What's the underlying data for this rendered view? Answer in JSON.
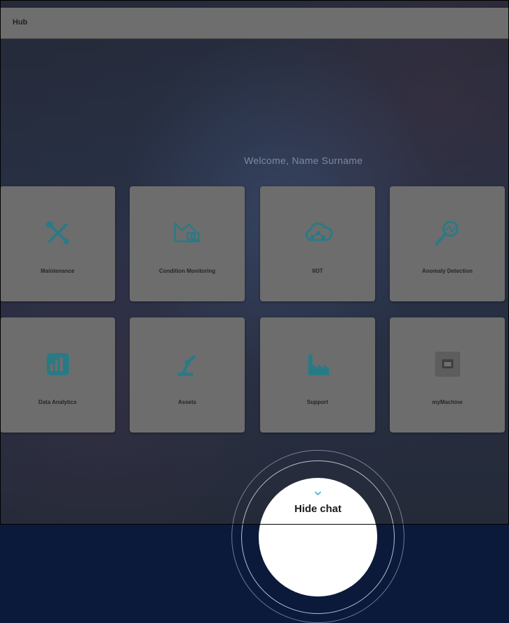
{
  "header": {
    "title": "Hub"
  },
  "welcome": "Welcome, Name Surname",
  "tiles": [
    {
      "label": "Maintenance",
      "icon": "tools-icon"
    },
    {
      "label": "Condition Monitoring",
      "icon": "monitoring-icon"
    },
    {
      "label": "IIOT",
      "icon": "cloud-network-icon"
    },
    {
      "label": "Anomaly Detection",
      "icon": "magnifier-icon"
    },
    {
      "label": "Data Analytics",
      "icon": "analytics-icon"
    },
    {
      "label": "Assets",
      "icon": "robot-arm-icon"
    },
    {
      "label": "Support",
      "icon": "factory-icon"
    },
    {
      "label": "myMachine",
      "icon": "machine-icon"
    }
  ],
  "chat": {
    "label": "Hide chat"
  },
  "colors": {
    "accent": "#2a7a86",
    "tile": "#6d6d6d",
    "header": "#6e6e6e"
  }
}
